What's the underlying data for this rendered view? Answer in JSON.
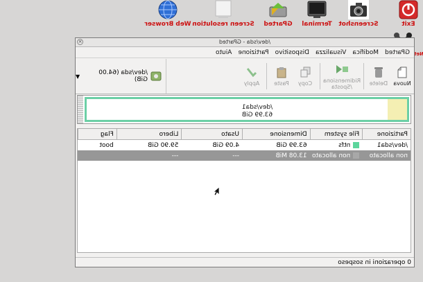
{
  "desktop": {
    "launchers": [
      {
        "label": "Exit",
        "icon": "power-icon"
      },
      {
        "label": "Screenshot",
        "icon": "camera-icon"
      },
      {
        "label": "Terminal",
        "icon": "terminal-icon"
      },
      {
        "label": "GParted",
        "icon": "gparted-icon"
      },
      {
        "label": "Screen resolution",
        "icon": "monitor-icon"
      },
      {
        "label": "Web Browser",
        "icon": "globe-icon"
      }
    ],
    "network_config": {
      "label": "Network config",
      "icon": "tools-icon"
    }
  },
  "window": {
    "title": "/dev/sda - GParted",
    "close_glyph": "×"
  },
  "menubar": [
    "GParted",
    "Modifica",
    "Visualizza",
    "Dispositivo",
    "Partizione",
    "Aiuto"
  ],
  "toolbar": {
    "new": "Nuova",
    "delete": "Delete",
    "resize": "Ridimensiona\n/Sposta",
    "copy": "Copy",
    "paste": "Paste",
    "apply": "Apply"
  },
  "device_selector": {
    "value": "/dev/sda  (64.00 GiB)",
    "arrow": "▼"
  },
  "disk_graphic": {
    "partition_name": "/dev/sda1",
    "partition_size": "63.99 GiB"
  },
  "table": {
    "headers": [
      "Partizione",
      "File system",
      "Dimensione",
      "Usato",
      "Libero",
      "Flag"
    ],
    "rows": [
      {
        "partition": "/dev/sda1",
        "fs": "ntfs",
        "size": "63.99 GiB",
        "used": "4.09 GiB",
        "free": "59.90 GiB",
        "flag": "boot",
        "fs_color": "#5cd59c"
      },
      {
        "partition": "non allocato",
        "fs": "non allocato",
        "size": "13.08 MiB",
        "used": "---",
        "free": "---",
        "flag": "",
        "fs_color": "#a8a8a8"
      }
    ]
  },
  "status": "0 operazioni in sospeso",
  "colors": {
    "launcher_label": "#cc1111",
    "selection": "#979797",
    "partition_border": "#6ccfa6",
    "unallocated": "#f4efb3"
  }
}
